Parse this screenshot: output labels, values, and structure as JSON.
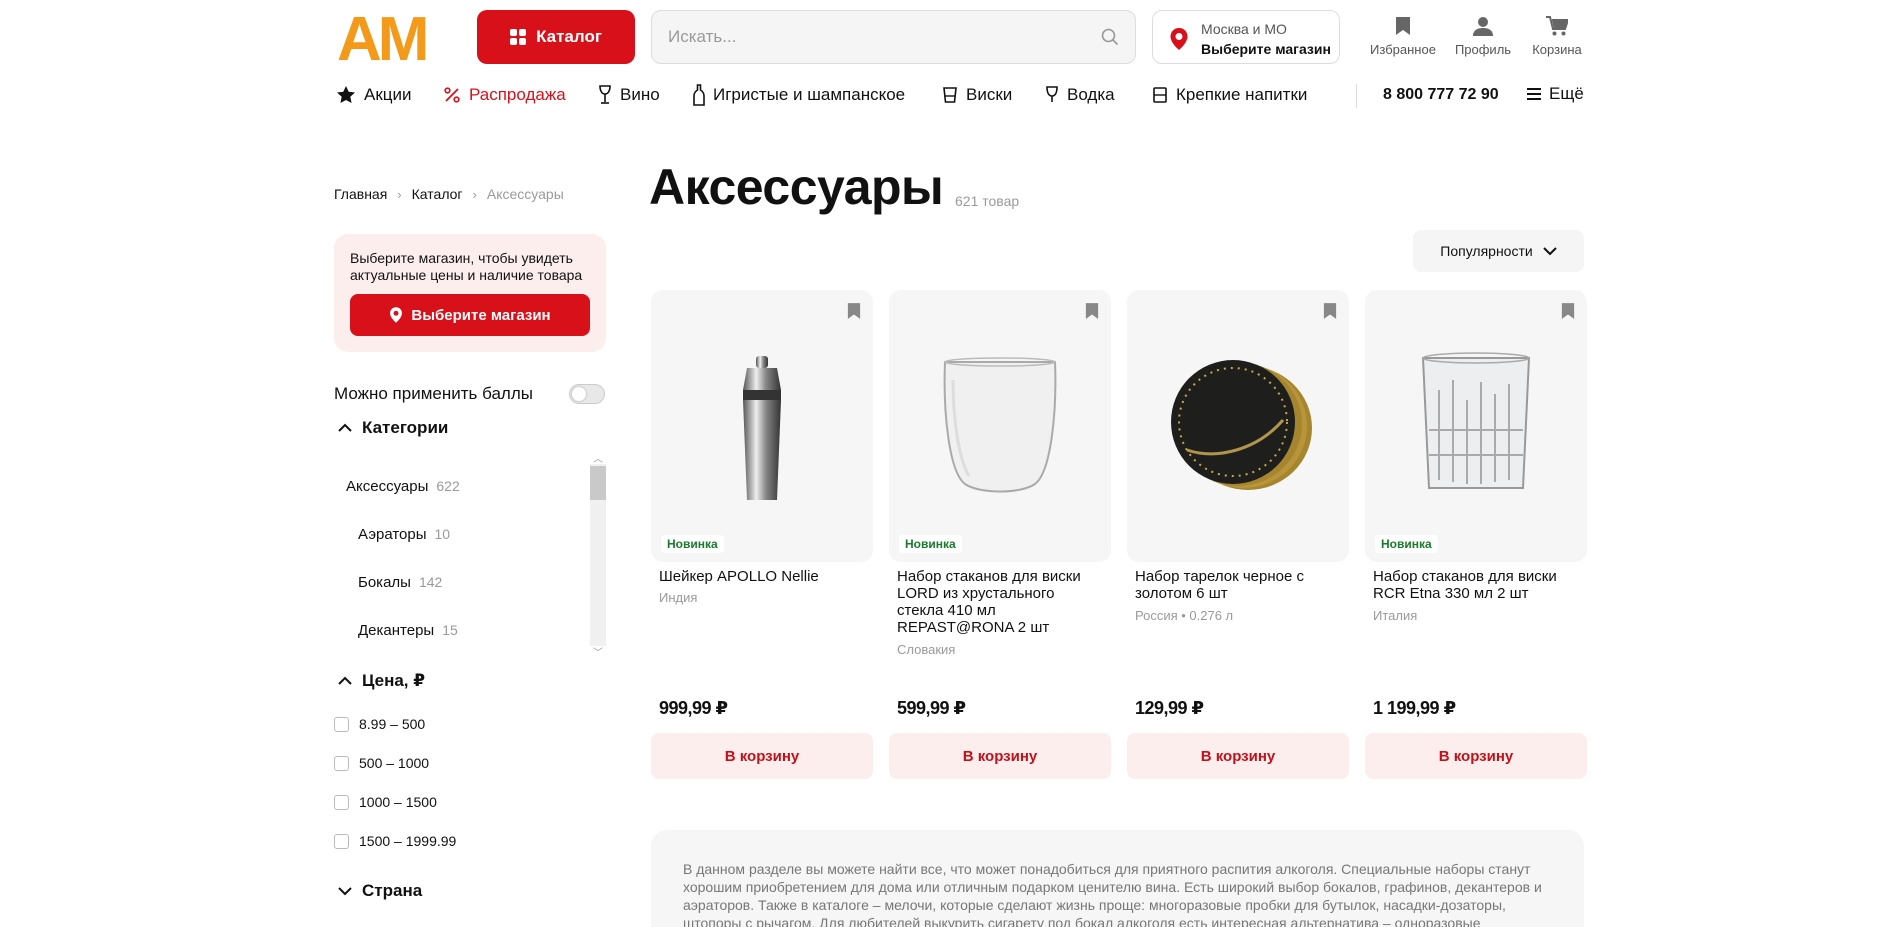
{
  "header": {
    "logo_text": "AM",
    "catalog_label": "Каталог",
    "search_placeholder": "Искать...",
    "store": {
      "region": "Москва и МО",
      "choose": "Выберите магазин"
    },
    "favorites_label": "Избранное",
    "profile_label": "Профиль",
    "cart_label": "Корзина",
    "brand_color": "#d8101a",
    "logo_color": "#f39a1b"
  },
  "nav": {
    "items": [
      {
        "label": "Акции",
        "icon": "star-icon"
      },
      {
        "label": "Распродажа",
        "icon": "percent-icon"
      },
      {
        "label": "Вино",
        "icon": "wine-glass-icon"
      },
      {
        "label": "Игристые и шампанское",
        "icon": "bottle-icon"
      },
      {
        "label": "Виски",
        "icon": "whisky-glass-icon"
      },
      {
        "label": "Водка",
        "icon": "shot-glass-icon"
      },
      {
        "label": "Крепкие напитки",
        "icon": "tumbler-icon"
      }
    ],
    "phone": "8 800 777 72 90",
    "more_label": "Ещё"
  },
  "breadcrumb": [
    "Главная",
    "Каталог",
    "Аксессуары"
  ],
  "sidebar": {
    "store_prompt": "Выберите магазин, чтобы увидеть актуальные цены и наличие товара",
    "store_button": "Выберите магазин",
    "points_label": "Можно применить баллы",
    "categories_title": "Категории",
    "categories": [
      {
        "label": "Аксессуары",
        "count": "622"
      },
      {
        "label": "Аэраторы",
        "count": "10"
      },
      {
        "label": "Бокалы",
        "count": "142"
      },
      {
        "label": "Декантеры",
        "count": "15"
      }
    ],
    "price_title": "Цена, ₽",
    "price_ranges": [
      "8.99 – 500",
      "500 – 1000",
      "1000 – 1500",
      "1500 – 1999.99"
    ],
    "country_title": "Страна"
  },
  "main": {
    "title": "Аксессуары",
    "count": "621 товар",
    "sort_label": "Популярности",
    "products": [
      {
        "badge": "Новинка",
        "name": "Шейкер APOLLO Nellie",
        "meta": "Индия",
        "price": "999,99 ₽",
        "button": "В корзину"
      },
      {
        "badge": "Новинка",
        "name": "Набор стаканов для виски LORD из хрустального стекла 410 мл REPAST@RONA 2 шт",
        "meta": "Словакия",
        "price": "599,99 ₽",
        "button": "В корзину"
      },
      {
        "badge": "",
        "name": "Набор тарелок черное с золотом 6 шт",
        "meta": "Россия • 0.276 л",
        "price": "129,99 ₽",
        "button": "В корзину"
      },
      {
        "badge": "Новинка",
        "name": "Набор стаканов для виски RCR Etna 330 мл 2 шт",
        "meta": "Италия",
        "price": "1 199,99 ₽",
        "button": "В корзину"
      }
    ],
    "description": "В данном разделе вы можете найти все, что может понадобиться для приятного распития алкоголя. Специальные наборы станут хорошим приобретением для дома или отличным подарком ценителю вина. Есть широкий выбор бокалов, графинов, декантеров и аэраторов. Также в каталоге – мелочи, которые сделают жизнь проще: многоразовые пробки для бутылок, насадки-дозаторы, штопоры с рычагом.  Для любителей выкурить сигарету под бокал алкоголя есть интересная альтернатива – одноразовые"
  }
}
